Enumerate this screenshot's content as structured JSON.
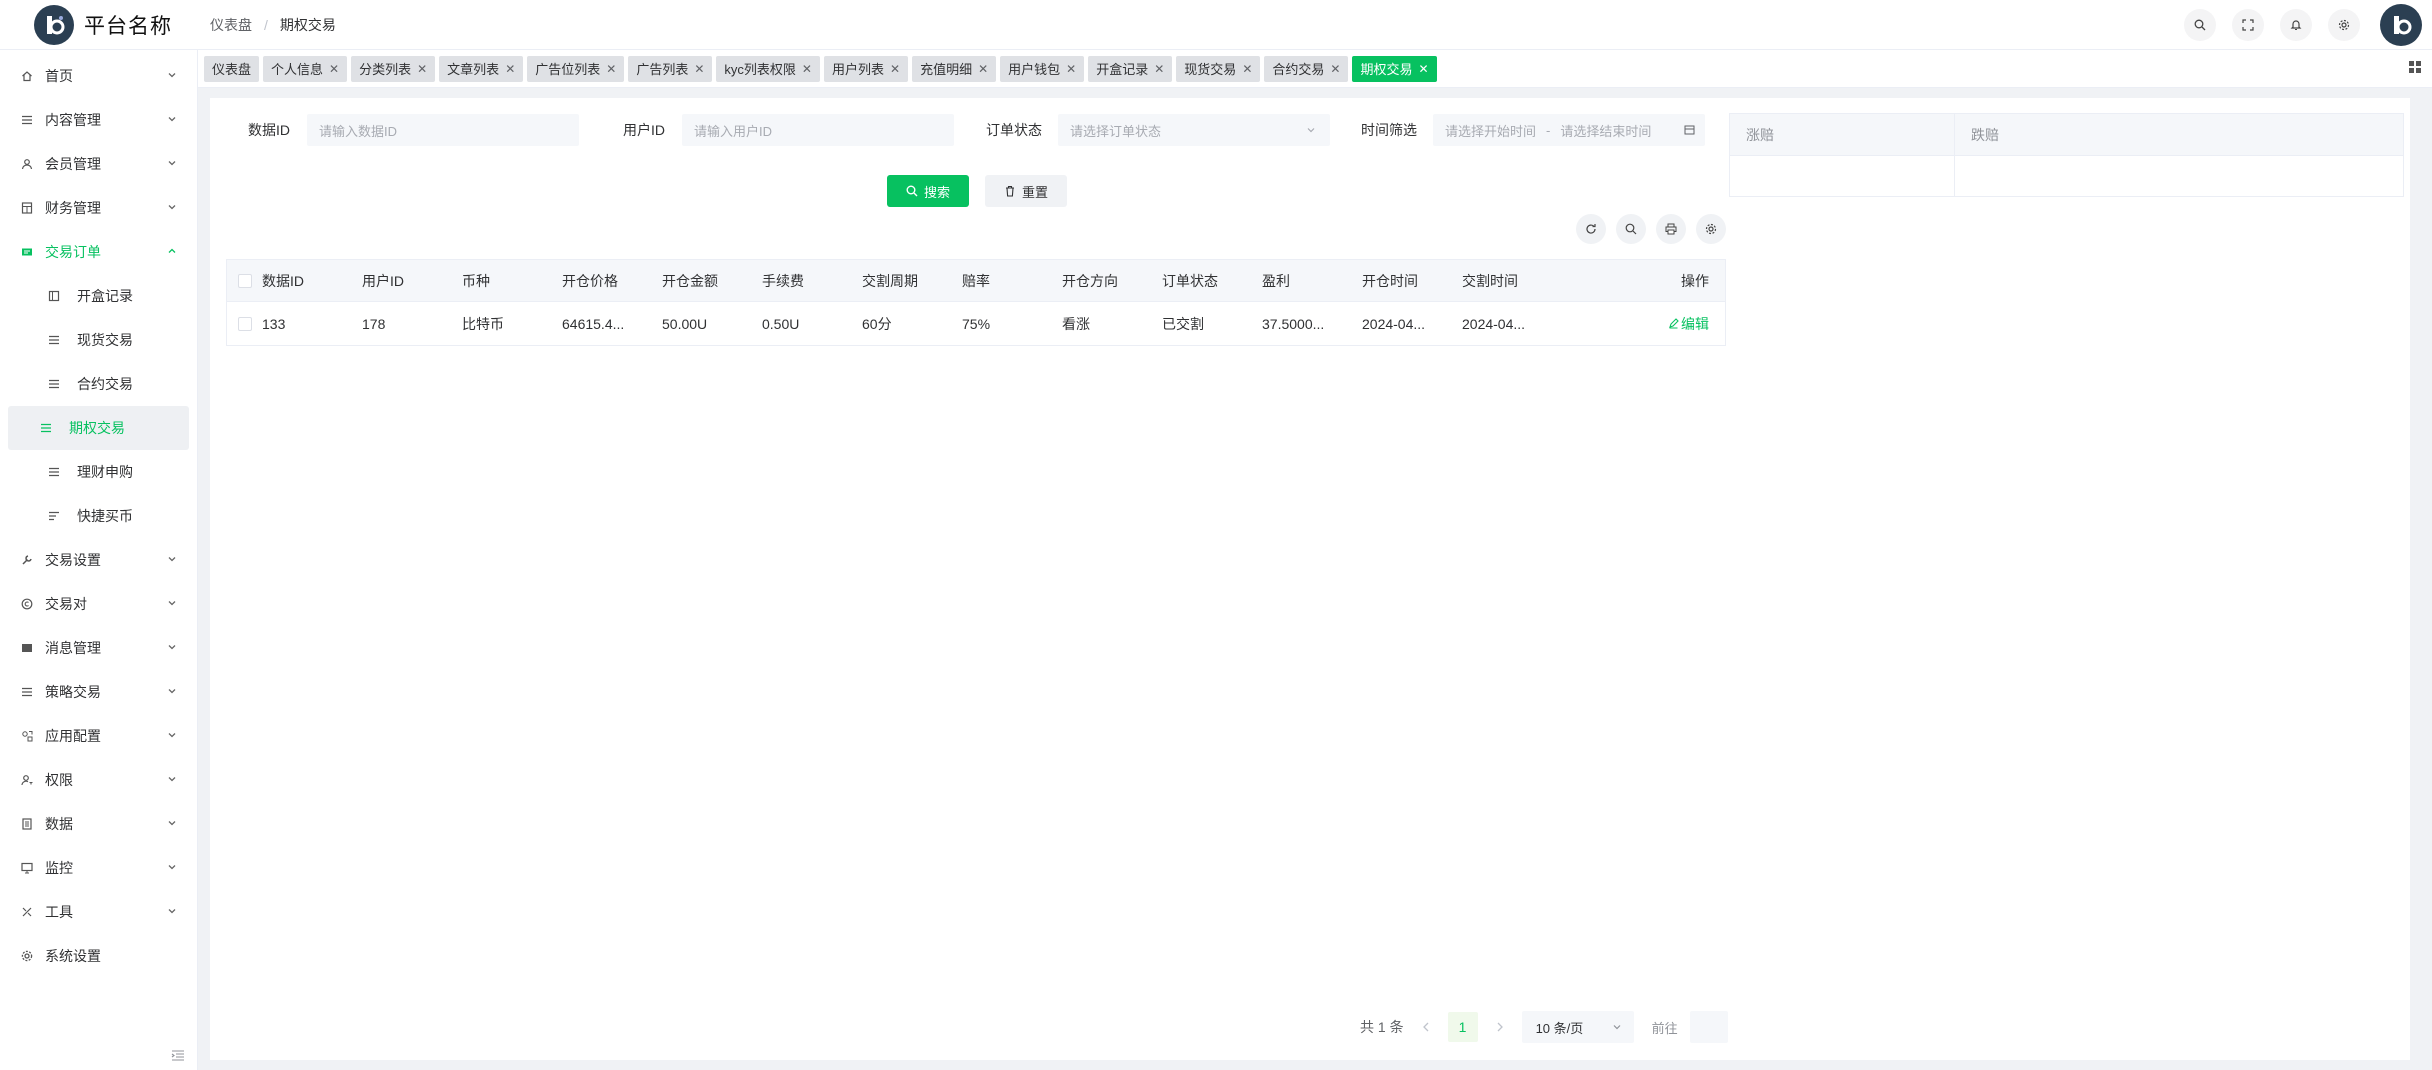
{
  "app": {
    "title": "平台名称"
  },
  "breadcrumb": {
    "home": "仪表盘",
    "current": "期权交易"
  },
  "sidebar": {
    "items_top": [
      {
        "label": "首页",
        "icon": "home-icon"
      },
      {
        "label": "内容管理",
        "icon": "list-icon"
      },
      {
        "label": "会员管理",
        "icon": "user-icon"
      },
      {
        "label": "财务管理",
        "icon": "calculator-icon"
      },
      {
        "label": "交易订单",
        "icon": "ticket-icon"
      }
    ],
    "sub_items": [
      {
        "label": "开盒记录",
        "icon": "box-icon"
      },
      {
        "label": "现货交易",
        "icon": "list-icon"
      },
      {
        "label": "合约交易",
        "icon": "list-icon"
      },
      {
        "label": "期权交易",
        "icon": "list-icon"
      },
      {
        "label": "理财申购",
        "icon": "list-icon"
      },
      {
        "label": "快捷买币",
        "icon": "lines-icon"
      }
    ],
    "items_bottom": [
      {
        "label": "交易设置",
        "icon": "wrench-icon"
      },
      {
        "label": "交易对",
        "icon": "copyright-icon"
      },
      {
        "label": "消息管理",
        "icon": "message-icon"
      },
      {
        "label": "策略交易",
        "icon": "list-icon"
      },
      {
        "label": "应用配置",
        "icon": "apps-icon"
      },
      {
        "label": "权限",
        "icon": "user-key-icon"
      },
      {
        "label": "数据",
        "icon": "data-icon"
      },
      {
        "label": "监控",
        "icon": "monitor-icon"
      },
      {
        "label": "工具",
        "icon": "tools-icon"
      }
    ],
    "last_item": {
      "label": "系统设置",
      "icon": "gear-icon"
    }
  },
  "tabs": [
    {
      "label": "仪表盘",
      "closable": false
    },
    {
      "label": "个人信息",
      "closable": true
    },
    {
      "label": "分类列表",
      "closable": true
    },
    {
      "label": "文章列表",
      "closable": true
    },
    {
      "label": "广告位列表",
      "closable": true
    },
    {
      "label": "广告列表",
      "closable": true
    },
    {
      "label": "kyc列表权限",
      "closable": true
    },
    {
      "label": "用户列表",
      "closable": true
    },
    {
      "label": "充值明细",
      "closable": true
    },
    {
      "label": "用户钱包",
      "closable": true
    },
    {
      "label": "开盒记录",
      "closable": true
    },
    {
      "label": "现货交易",
      "closable": true
    },
    {
      "label": "合约交易",
      "closable": true
    },
    {
      "label": "期权交易",
      "closable": true,
      "active": true
    }
  ],
  "filters": {
    "data_id": {
      "label": "数据ID",
      "placeholder": "请输入数据ID"
    },
    "user_id": {
      "label": "用户ID",
      "placeholder": "请输入用户ID"
    },
    "order_status": {
      "label": "订单状态",
      "placeholder": "请选择订单状态"
    },
    "time": {
      "label": "时间筛选",
      "start": "请选择开始时间",
      "sep": "-",
      "end": "请选择结束时间"
    },
    "search_label": "搜索",
    "reset_label": "重置"
  },
  "table": {
    "columns": [
      "数据ID",
      "用户ID",
      "币种",
      "开仓价格",
      "开仓金额",
      "手续费",
      "交割周期",
      "赔率",
      "开仓方向",
      "订单状态",
      "盈利",
      "开仓时间",
      "交割时间",
      "操作"
    ],
    "rows": [
      {
        "cells": [
          "133",
          "178",
          "比特币",
          "64615.4...",
          "50.00U",
          "0.50U",
          "60分",
          "75%",
          "看涨",
          "已交割",
          "37.5000...",
          "2024-04...",
          "2024-04..."
        ],
        "action": "编辑"
      }
    ]
  },
  "side_panel": {
    "col1": "涨赔",
    "col2": "跌赔"
  },
  "pagination": {
    "total": "共 1 条",
    "current_page": "1",
    "page_size": "10 条/页",
    "goto": "前往"
  },
  "colors": {
    "accent": "#07c160"
  }
}
